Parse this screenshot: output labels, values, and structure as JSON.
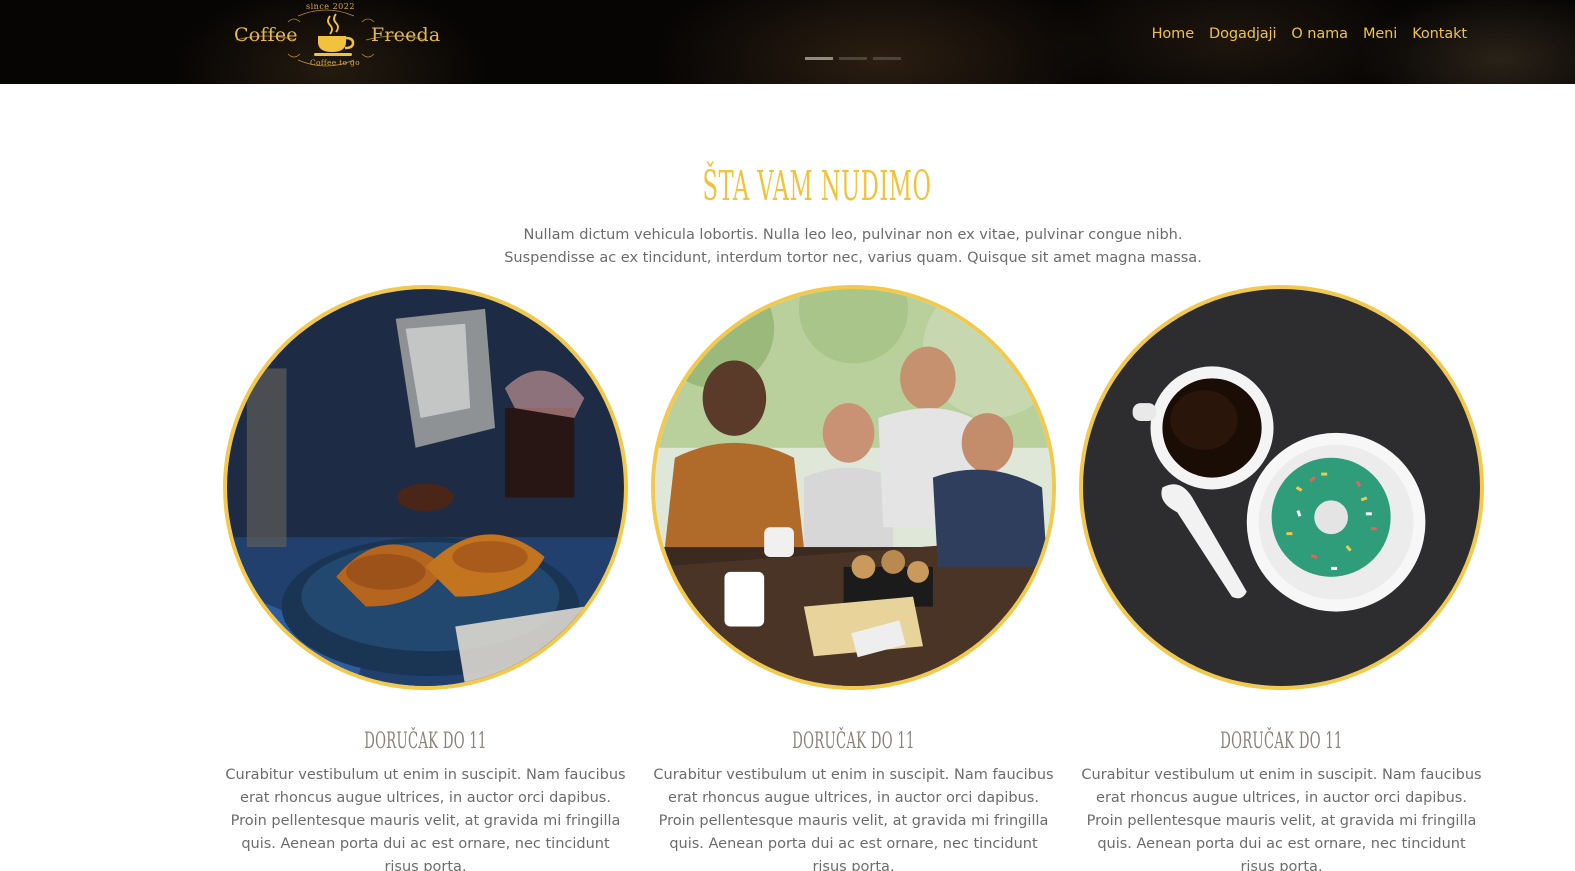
{
  "header": {
    "logo": {
      "word_left": "Coffee",
      "word_right": "Freeda",
      "since": "since 2022",
      "tagline": "Coffee to go",
      "icon": "coffee-cup-icon"
    },
    "slider_dots": 3,
    "nav": [
      {
        "label": "Home"
      },
      {
        "label": "Dogadjaji"
      },
      {
        "label": "O nama"
      },
      {
        "label": "Meni"
      },
      {
        "label": "Kontakt"
      }
    ]
  },
  "section": {
    "title": "Šta vam nudimo",
    "intro_line1": "Nullam dictum vehicula lobortis. Nulla leo leo, pulvinar non ex vitae, pulvinar congue nibh.",
    "intro_line2": "Suspendisse ac ex tincidunt, interdum tortor nec, varius quam. Quisque sit amet magna massa.",
    "cards": [
      {
        "title": "Doručak do 11",
        "text": "Curabitur vestibulum ut enim in suscipit. Nam faucibus erat rhoncus augue ultrices, in auctor orci dapibus. Proin pellentesque mauris velit, at gravida mi fringilla quis. Aenean porta dui ac est ornare, nec tincidunt risus porta.",
        "image": "croissants-coffee-pot-photo"
      },
      {
        "title": "Doručak do 11",
        "text": "Curabitur vestibulum ut enim in suscipit. Nam faucibus erat rhoncus augue ultrices, in auctor orci dapibus. Proin pellentesque mauris velit, at gravida mi fringilla quis. Aenean porta dui ac est ornare, nec tincidunt risus porta.",
        "image": "friends-at-cafe-photo"
      },
      {
        "title": "Doručak do 11",
        "text": "Curabitur vestibulum ut enim in suscipit. Nam faucibus erat rhoncus augue ultrices, in auctor orci dapibus. Proin pellentesque mauris velit, at gravida mi fringilla quis. Aenean porta dui ac est ornare, nec tincidunt risus porta.",
        "image": "coffee-and-donut-photo"
      }
    ]
  },
  "colors": {
    "accent": "#f2c23c",
    "circle_border": "#f2c94c",
    "header_bg": "#000000",
    "body_text": "#6c6c6c"
  }
}
